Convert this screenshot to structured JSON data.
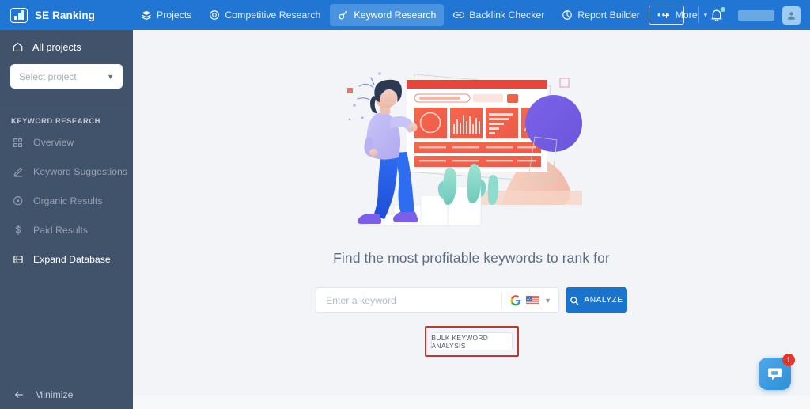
{
  "topbar": {
    "brand": "SE Ranking",
    "brand_icon": "bar-chart-logo-icon",
    "nav": [
      {
        "label": "Projects",
        "icon": "layers-icon",
        "active": false
      },
      {
        "label": "Competitive Research",
        "icon": "target-icon",
        "active": false
      },
      {
        "label": "Keyword Research",
        "icon": "key-icon",
        "active": true
      },
      {
        "label": "Backlink Checker",
        "icon": "link-icon",
        "active": false
      },
      {
        "label": "Report Builder",
        "icon": "pie-chart-icon",
        "active": false
      },
      {
        "label": "More",
        "icon": "dots-icon",
        "active": false
      }
    ],
    "add_button": "+",
    "notifications_icon": "bell-icon",
    "avatar_icon": "user-avatar-icon",
    "accent_color": "#2076d2",
    "active_tab_color": "#4a93de"
  },
  "sidebar": {
    "all_projects": "All projects",
    "all_projects_icon": "home-icon",
    "project_select": {
      "placeholder": "Select project",
      "value": ""
    },
    "section_title": "KEYWORD RESEARCH",
    "items": [
      {
        "label": "Overview",
        "icon": "grid-icon",
        "highlighted": false
      },
      {
        "label": "Keyword Suggestions",
        "icon": "pen-icon",
        "highlighted": false
      },
      {
        "label": "Organic Results",
        "icon": "circle-dot-icon",
        "highlighted": false
      },
      {
        "label": "Paid Results",
        "icon": "dollar-icon",
        "highlighted": false
      },
      {
        "label": "Expand Database",
        "icon": "database-icon",
        "highlighted": true
      }
    ],
    "minimize": "Minimize",
    "minimize_icon": "arrow-left-icon",
    "background_color": "#41536b"
  },
  "main": {
    "hero_illustration": "person-analyzing-dashboard-illustration",
    "headline": "Find the most profitable keywords to rank for",
    "search": {
      "placeholder": "Enter a keyword",
      "value": "",
      "engine_icon": "google-g-icon",
      "region_icon": "us-flag-icon",
      "dropdown_icon": "chevron-down-icon",
      "analyze_label": "ANALYZE",
      "analyze_icon": "search-icon",
      "analyze_color": "#1a73cd"
    },
    "bulk_button": "BULK KEYWORD ANALYSIS",
    "highlight_color": "#c0392b",
    "background_color": "#f2f4f7"
  },
  "chat": {
    "icon": "chat-bubble-icon",
    "badge": "1",
    "badge_color": "#e0392b"
  }
}
